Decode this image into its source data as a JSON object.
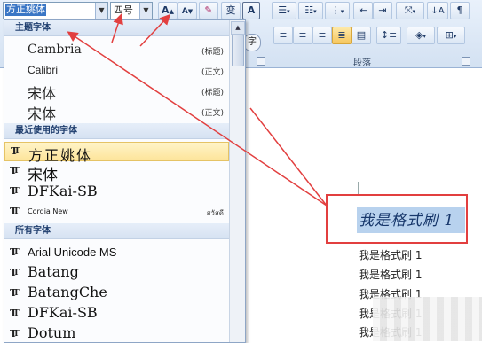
{
  "ribbon": {
    "font_name": "方正姚体",
    "font_size": "四号",
    "grow_font": "A",
    "shrink_font": "A",
    "clear_format": "变",
    "char_border": "A",
    "paragraph_group_label": "段落"
  },
  "dropdown": {
    "theme_header": "主题字体",
    "theme_fonts": [
      {
        "name": "Cambria",
        "role": "(标题)"
      },
      {
        "name": "Calibri",
        "role": "(正文)"
      },
      {
        "name": "宋体",
        "role": "(标题)"
      },
      {
        "name": "宋体",
        "role": "(正文)"
      }
    ],
    "recent_header": "最近使用的字体",
    "recent_fonts": [
      {
        "name": "方正姚体"
      },
      {
        "name": "宋体"
      },
      {
        "name": "DFKai-SB"
      },
      {
        "name": "Cordia New",
        "sample": "สวัสดี"
      }
    ],
    "all_header": "所有字体",
    "all_fonts": [
      {
        "name": "Arial Unicode MS"
      },
      {
        "name": "Batang"
      },
      {
        "name": "BatangChe"
      },
      {
        "name": "DFKai-SB"
      },
      {
        "name": "Dotum"
      }
    ]
  },
  "document": {
    "highlighted_text": "我是格式刷 1",
    "lines": [
      "我是格式刷 1",
      "我是格式刷 1",
      "我是格式刷 1",
      "我是格式刷 1",
      "我是格式刷 1"
    ]
  },
  "colors": {
    "annotation_red": "#e23f3f",
    "selection_blue": "#b8d2ee",
    "recent_highlight": "#fde49a"
  }
}
